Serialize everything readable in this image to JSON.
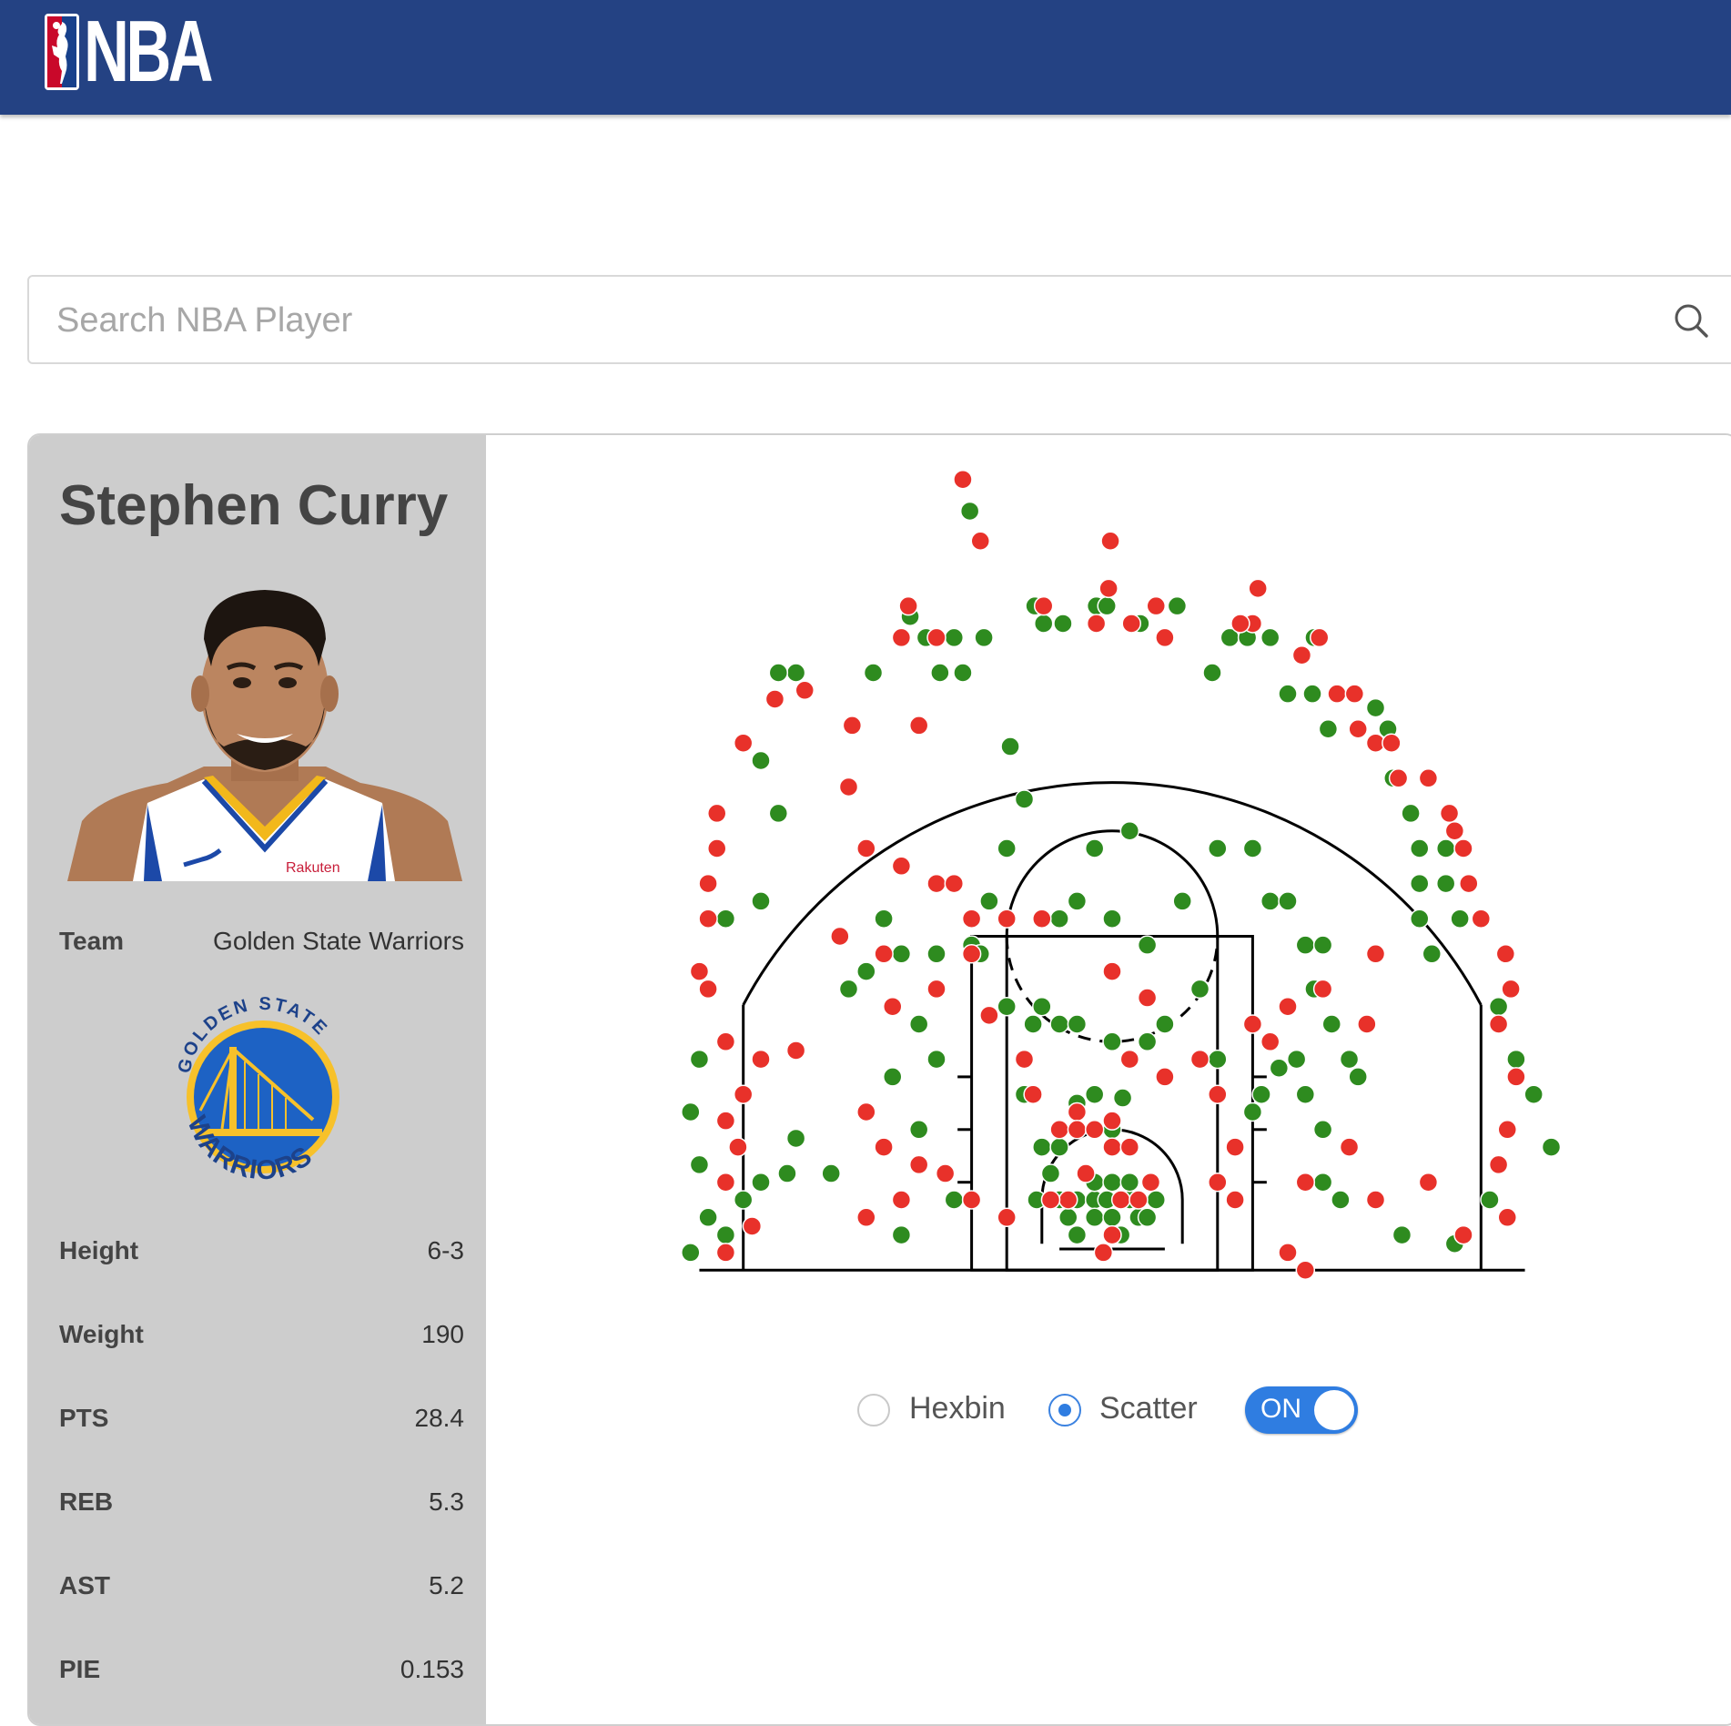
{
  "header": {
    "logo_text": "NBA",
    "logo_icon": "nba-logo-icon"
  },
  "search": {
    "placeholder": "Search NBA Player",
    "value": "",
    "icon": "search-icon"
  },
  "player": {
    "name": "Stephen Curry",
    "photo_icon": "player-headshot",
    "team_label": "Team",
    "team": "Golden State Warriors",
    "team_logo_icon": "golden-state-warriors-logo",
    "stats": [
      {
        "label": "Height",
        "value": "6-3"
      },
      {
        "label": "Weight",
        "value": "190"
      },
      {
        "label": "PTS",
        "value": "28.4"
      },
      {
        "label": "REB",
        "value": "5.3"
      },
      {
        "label": "AST",
        "value": "5.2"
      },
      {
        "label": "PIE",
        "value": "0.153"
      }
    ]
  },
  "chart_controls": {
    "options": [
      {
        "label": "Hexbin",
        "selected": false
      },
      {
        "label": "Scatter",
        "selected": true
      }
    ],
    "toggle": {
      "label": "ON",
      "on": true
    }
  },
  "colors": {
    "header": "#244283",
    "made": "#2e8b1f",
    "missed": "#e8312a",
    "accent": "#2f7de1",
    "sidebar": "#cdcdcd"
  },
  "chart_data": {
    "type": "scatter",
    "title": "",
    "xlabel": "",
    "ylabel": "",
    "units": "feet from basket",
    "grid": false,
    "legend": "none",
    "xlim": [
      -25,
      25
    ],
    "ylim": [
      -4,
      43
    ],
    "series": [
      {
        "result": "made",
        "color": "#2e8b1f",
        "points": [
          [
            -8.1,
            39.2
          ],
          [
            -11.5,
            33.2
          ],
          [
            -10.6,
            32.0
          ],
          [
            -9.0,
            32.0
          ],
          [
            -7.3,
            32.0
          ],
          [
            -8.5,
            30.0
          ],
          [
            -9.8,
            30.0
          ],
          [
            -13.6,
            30.0
          ],
          [
            -3.9,
            32.8
          ],
          [
            -2.8,
            32.8
          ],
          [
            -4.4,
            33.8
          ],
          [
            -0.9,
            33.8
          ],
          [
            -0.3,
            33.8
          ],
          [
            1.6,
            32.8
          ],
          [
            3.7,
            33.8
          ],
          [
            5.7,
            30.0
          ],
          [
            6.7,
            32.0
          ],
          [
            7.7,
            32.0
          ],
          [
            9.0,
            32.0
          ],
          [
            11.5,
            32.0
          ],
          [
            10.0,
            28.8
          ],
          [
            11.4,
            28.8
          ],
          [
            12.3,
            26.8
          ],
          [
            15.0,
            28.0
          ],
          [
            15.7,
            26.8
          ],
          [
            16.0,
            24.0
          ],
          [
            17.0,
            22.0
          ],
          [
            17.5,
            20.0
          ],
          [
            19.0,
            20.0
          ],
          [
            17.5,
            18.0
          ],
          [
            19.0,
            18.0
          ],
          [
            19.8,
            16.0
          ],
          [
            17.5,
            16.0
          ],
          [
            18.2,
            14.0
          ],
          [
            22.0,
            11.0
          ],
          [
            23.0,
            8.0
          ],
          [
            24.0,
            6.0
          ],
          [
            25.0,
            3.0
          ],
          [
            -18.0,
            30.0
          ],
          [
            -19.0,
            30.0
          ],
          [
            -20.0,
            25.0
          ],
          [
            -19.0,
            22.0
          ],
          [
            -20.0,
            17.0
          ],
          [
            -22.0,
            16.0
          ],
          [
            -23.0,
            12.0
          ],
          [
            -23.5,
            8.0
          ],
          [
            -24.0,
            5.0
          ],
          [
            -23.5,
            2.0
          ],
          [
            -23.0,
            -1.0
          ],
          [
            -24.0,
            -3.0
          ],
          [
            -21.0,
            0.0
          ],
          [
            -22.0,
            -2.0
          ],
          [
            -20.0,
            1.0
          ],
          [
            -18.5,
            1.5
          ],
          [
            -5.8,
            25.8
          ],
          [
            -5.0,
            22.8
          ],
          [
            1.0,
            21.0
          ],
          [
            -1.0,
            20.0
          ],
          [
            -2.0,
            17.0
          ],
          [
            -3.0,
            16.0
          ],
          [
            0.0,
            16.0
          ],
          [
            2.0,
            14.5
          ],
          [
            4.0,
            17.0
          ],
          [
            6.0,
            20.0
          ],
          [
            8.0,
            20.0
          ],
          [
            9.0,
            17.0
          ],
          [
            10.0,
            17.0
          ],
          [
            11.0,
            14.5
          ],
          [
            12.0,
            14.5
          ],
          [
            -6.0,
            20.0
          ],
          [
            -7.0,
            17.0
          ],
          [
            -8.0,
            14.5
          ],
          [
            -10.0,
            14.0
          ],
          [
            -12.0,
            14.0
          ],
          [
            -13.0,
            16.0
          ],
          [
            -14.0,
            13.0
          ],
          [
            -15.0,
            12.0
          ],
          [
            -11.0,
            10.0
          ],
          [
            -10.0,
            8.0
          ],
          [
            -7.5,
            14.0
          ],
          [
            -6.0,
            11.0
          ],
          [
            -4.0,
            11.0
          ],
          [
            -3.0,
            10.0
          ],
          [
            -2.0,
            10.0
          ],
          [
            0.0,
            9.0
          ],
          [
            2.0,
            9.0
          ],
          [
            3.0,
            10.0
          ],
          [
            5.0,
            12.0
          ],
          [
            6.0,
            8.0
          ],
          [
            -4.5,
            10.0
          ],
          [
            -5.0,
            6.0
          ],
          [
            -2.0,
            5.5
          ],
          [
            -1.0,
            6.0
          ],
          [
            0.0,
            4.0
          ],
          [
            0.6,
            5.8
          ],
          [
            -1.5,
            1.5
          ],
          [
            -3.5,
            1.5
          ],
          [
            -4.3,
            0.0
          ],
          [
            -3.0,
            0.0
          ],
          [
            -2.0,
            0.0
          ],
          [
            -1.0,
            0.0
          ],
          [
            -0.3,
            0.0
          ],
          [
            1.0,
            0.0
          ],
          [
            1.5,
            -1.0
          ],
          [
            2.0,
            -1.0
          ],
          [
            2.5,
            0.0
          ],
          [
            -2.0,
            -2.0
          ],
          [
            -2.5,
            -1.0
          ],
          [
            -1.0,
            -1.0
          ],
          [
            0.0,
            -1.0
          ],
          [
            0.5,
            -2.0
          ],
          [
            -9.0,
            0.0
          ],
          [
            -4.0,
            3.0
          ],
          [
            -3.0,
            3.0
          ],
          [
            -1.0,
            1.0
          ],
          [
            0.0,
            1.0
          ],
          [
            1.0,
            1.0
          ],
          [
            -12.0,
            -2.0
          ],
          [
            -16.0,
            1.5
          ],
          [
            -18.0,
            3.5
          ],
          [
            -11.0,
            4.0
          ],
          [
            -12.5,
            7.0
          ],
          [
            8.0,
            5.0
          ],
          [
            11.0,
            6.0
          ],
          [
            12.0,
            4.0
          ],
          [
            8.5,
            6.0
          ],
          [
            9.5,
            7.5
          ],
          [
            10.5,
            8.0
          ],
          [
            12.5,
            10.0
          ],
          [
            14.0,
            7.0
          ],
          [
            13.5,
            8.0
          ],
          [
            12.0,
            1.0
          ],
          [
            16.5,
            -2.0
          ],
          [
            13.0,
            0.0
          ],
          [
            21.5,
            0.0
          ],
          [
            19.5,
            -2.5
          ],
          [
            10.0,
            11.0
          ],
          [
            11.5,
            12.0
          ]
        ]
      },
      {
        "result": "missed",
        "color": "#e8312a",
        "points": [
          [
            -8.5,
            41.0
          ],
          [
            -0.1,
            37.5
          ],
          [
            -0.2,
            34.8
          ],
          [
            8.3,
            34.8
          ],
          [
            -11.6,
            33.8
          ],
          [
            -12.0,
            32.0
          ],
          [
            -10.0,
            32.0
          ],
          [
            -3.9,
            33.8
          ],
          [
            -0.9,
            32.8
          ],
          [
            1.1,
            32.8
          ],
          [
            2.5,
            33.8
          ],
          [
            3.0,
            32.0
          ],
          [
            8.0,
            32.8
          ],
          [
            7.3,
            32.8
          ],
          [
            11.8,
            32.0
          ],
          [
            10.8,
            31.0
          ],
          [
            12.8,
            28.8
          ],
          [
            13.8,
            28.8
          ],
          [
            14.0,
            26.8
          ],
          [
            15.0,
            26.0
          ],
          [
            15.9,
            26.0
          ],
          [
            16.3,
            24.0
          ],
          [
            18.0,
            24.0
          ],
          [
            19.2,
            22.0
          ],
          [
            19.5,
            21.0
          ],
          [
            20.0,
            20.0
          ],
          [
            20.3,
            18.0
          ],
          [
            21.0,
            16.0
          ],
          [
            22.4,
            14.0
          ],
          [
            22.7,
            12.0
          ],
          [
            22.0,
            10.0
          ],
          [
            23.0,
            7.0
          ],
          [
            22.5,
            4.0
          ],
          [
            22.0,
            2.0
          ],
          [
            22.5,
            -1.0
          ],
          [
            -17.5,
            29.0
          ],
          [
            -19.2,
            28.5
          ],
          [
            -21.0,
            26.0
          ],
          [
            -22.5,
            22.0
          ],
          [
            -22.5,
            20.0
          ],
          [
            -23.0,
            18.0
          ],
          [
            -23.0,
            16.0
          ],
          [
            -23.5,
            13.0
          ],
          [
            -23.0,
            12.0
          ],
          [
            -22.0,
            9.0
          ],
          [
            -21.0,
            6.0
          ],
          [
            -21.3,
            3.0
          ],
          [
            -22.0,
            1.0
          ],
          [
            -22.0,
            -3.0
          ],
          [
            -7.5,
            37.5
          ],
          [
            -14.8,
            27.0
          ],
          [
            -11.0,
            27.0
          ],
          [
            -15.0,
            23.5
          ],
          [
            -14.0,
            20.0
          ],
          [
            -12.0,
            19.0
          ],
          [
            -10.0,
            18.0
          ],
          [
            -9.0,
            18.0
          ],
          [
            -8.0,
            16.0
          ],
          [
            -15.5,
            15.0
          ],
          [
            -13.0,
            14.0
          ],
          [
            -12.5,
            11.0
          ],
          [
            -10.0,
            12.0
          ],
          [
            -7.0,
            10.5
          ],
          [
            -5.0,
            8.0
          ],
          [
            -4.5,
            6.0
          ],
          [
            -2.0,
            5.0
          ],
          [
            0.0,
            4.5
          ],
          [
            1.0,
            8.0
          ],
          [
            3.0,
            7.0
          ],
          [
            5.0,
            8.0
          ],
          [
            6.0,
            6.0
          ],
          [
            7.0,
            3.0
          ],
          [
            8.0,
            10.0
          ],
          [
            9.0,
            9.0
          ],
          [
            10.0,
            11.0
          ],
          [
            12.0,
            12.0
          ],
          [
            14.5,
            10.0
          ],
          [
            15.0,
            14.0
          ],
          [
            -4.0,
            16.0
          ],
          [
            -6.0,
            16.0
          ],
          [
            -8.0,
            14.0
          ],
          [
            0.0,
            13.0
          ],
          [
            2.0,
            11.5
          ],
          [
            -3.0,
            4.0
          ],
          [
            -2.0,
            4.0
          ],
          [
            -1.0,
            4.0
          ],
          [
            0.0,
            3.0
          ],
          [
            1.0,
            3.0
          ],
          [
            -1.5,
            1.5
          ],
          [
            -2.5,
            0.0
          ],
          [
            -3.5,
            0.0
          ],
          [
            0.5,
            0.0
          ],
          [
            1.5,
            0.0
          ],
          [
            2.2,
            1.0
          ],
          [
            -6.0,
            -1.0
          ],
          [
            -8.0,
            0.0
          ],
          [
            -9.5,
            1.5
          ],
          [
            -11.0,
            2.0
          ],
          [
            -12.0,
            0.0
          ],
          [
            -13.0,
            3.0
          ],
          [
            -14.0,
            5.0
          ],
          [
            6.0,
            1.0
          ],
          [
            7.0,
            0.0
          ],
          [
            10.0,
            -3.0
          ],
          [
            11.0,
            1.0
          ],
          [
            13.5,
            3.0
          ],
          [
            15.0,
            0.0
          ],
          [
            18.0,
            1.0
          ],
          [
            20.0,
            -2.0
          ],
          [
            -20.5,
            -1.5
          ],
          [
            -22.0,
            4.5
          ],
          [
            -20.0,
            8.0
          ],
          [
            -18.0,
            8.5
          ],
          [
            -14.0,
            -1.0
          ],
          [
            11.0,
            -4.0
          ],
          [
            -0.5,
            -3.0
          ],
          [
            0.0,
            -2.0
          ]
        ]
      }
    ]
  }
}
